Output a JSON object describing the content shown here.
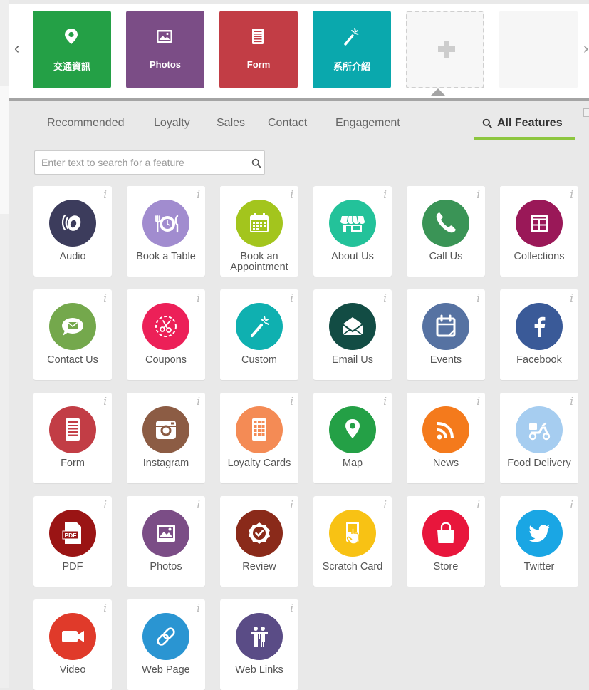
{
  "pages_bar": {
    "tiles": [
      {
        "label": "交通資訊",
        "icon": "map-pin-icon",
        "color": "#24a046"
      },
      {
        "label": "Photos",
        "icon": "photo-icon",
        "color": "#7b4d86"
      },
      {
        "label": "Form",
        "icon": "form-icon",
        "color": "#c23d45"
      },
      {
        "label": "系所介紹",
        "icon": "magic-wand-icon",
        "color": "#0aa8ad"
      }
    ],
    "add_tile_icon": "plus-icon",
    "prev_arrow": "‹",
    "next_arrow": "›"
  },
  "tabs": {
    "items": [
      "Recommended",
      "Loyalty",
      "Sales",
      "Contact",
      "Engagement"
    ],
    "active": "All Features"
  },
  "search": {
    "placeholder": "Enter text to search for a feature"
  },
  "info_glyph": "i",
  "features": [
    {
      "label": "Audio",
      "icon": "audio-icon",
      "color": "#3c3c5c"
    },
    {
      "label": "Book a Table",
      "icon": "plate-cutlery-icon",
      "color": "#a18ccf"
    },
    {
      "label": "Book an Appointment",
      "icon": "calendar-icon",
      "color": "#a3c51d"
    },
    {
      "label": "About Us",
      "icon": "storefront-icon",
      "color": "#23c29a"
    },
    {
      "label": "Call Us",
      "icon": "phone-icon",
      "color": "#3a9456"
    },
    {
      "label": "Collections",
      "icon": "collections-icon",
      "color": "#9a1858"
    },
    {
      "label": "Contact Us",
      "icon": "chat-bubble-icon",
      "color": "#74a84c"
    },
    {
      "label": "Coupons",
      "icon": "coupon-scissors-icon",
      "color": "#ec2058"
    },
    {
      "label": "Custom",
      "icon": "magic-wand-icon",
      "color": "#0fb0b0"
    },
    {
      "label": "Email Us",
      "icon": "envelope-icon",
      "color": "#124c44"
    },
    {
      "label": "Events",
      "icon": "event-note-icon",
      "color": "#5672a2"
    },
    {
      "label": "Facebook",
      "icon": "facebook-icon",
      "color": "#3a5a98"
    },
    {
      "label": "Form",
      "icon": "form-icon",
      "color": "#c23d45"
    },
    {
      "label": "Instagram",
      "icon": "instagram-icon",
      "color": "#8c5c44"
    },
    {
      "label": "Loyalty Cards",
      "icon": "loyalty-card-icon",
      "color": "#f48b55"
    },
    {
      "label": "Map",
      "icon": "map-pin-icon",
      "color": "#24a046"
    },
    {
      "label": "News",
      "icon": "rss-icon",
      "color": "#f47a1c"
    },
    {
      "label": "Food Delivery",
      "icon": "scooter-icon",
      "color": "#a6cdf0"
    },
    {
      "label": "PDF",
      "icon": "pdf-icon",
      "color": "#9a1414"
    },
    {
      "label": "Photos",
      "icon": "photo-icon",
      "color": "#7b4d86"
    },
    {
      "label": "Review",
      "icon": "review-badge-icon",
      "color": "#8a2a1a"
    },
    {
      "label": "Scratch Card",
      "icon": "scratch-card-icon",
      "color": "#f8c214"
    },
    {
      "label": "Store",
      "icon": "shopping-bag-icon",
      "color": "#e8163c"
    },
    {
      "label": "Twitter",
      "icon": "twitter-icon",
      "color": "#1aa6e4"
    },
    {
      "label": "Video",
      "icon": "video-camera-icon",
      "color": "#e03a2a"
    },
    {
      "label": "Web Page",
      "icon": "link-icon",
      "color": "#2a95d2"
    },
    {
      "label": "Web Links",
      "icon": "people-link-icon",
      "color": "#5a4c86"
    }
  ]
}
